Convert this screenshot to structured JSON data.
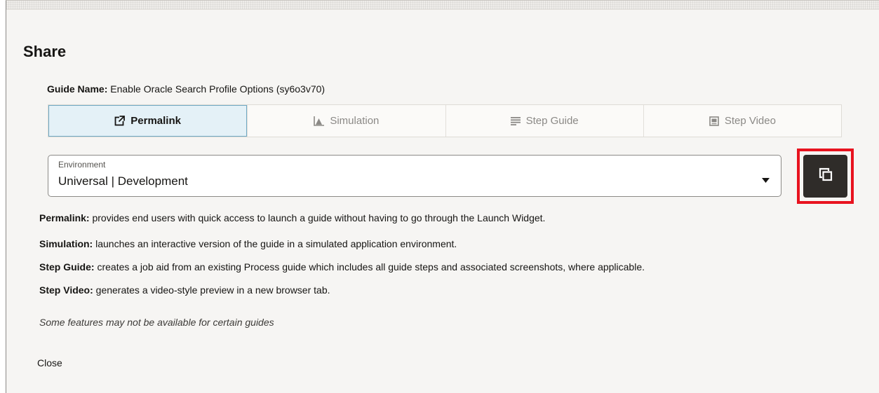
{
  "dialog": {
    "title": "Share",
    "guide_name_label": "Guide Name:",
    "guide_name_value": "Enable Oracle Search Profile Options (sy6o3v70)"
  },
  "tabs": [
    {
      "label": "Permalink",
      "icon": "external-link-icon",
      "active": true
    },
    {
      "label": "Simulation",
      "icon": "chart-icon",
      "active": false
    },
    {
      "label": "Step Guide",
      "icon": "lines-icon",
      "active": false
    },
    {
      "label": "Step Video",
      "icon": "video-icon",
      "active": false
    }
  ],
  "environment": {
    "label": "Environment",
    "value": "Universal | Development"
  },
  "copy_button": {
    "icon": "copy-icon",
    "highlight_color": "#e8131f"
  },
  "descriptions": [
    {
      "term": "Permalink:",
      "text": "provides end users with quick access to launch a guide without having to go through the Launch Widget."
    },
    {
      "term": "Simulation:",
      "text": "launches an interactive version of the guide in a simulated application environment."
    },
    {
      "term": "Step Guide:",
      "text": "creates a job aid from an existing Process guide which includes all guide steps and associated screenshots, where applicable."
    },
    {
      "term": "Step Video:",
      "text": "generates a video-style preview in a new browser tab."
    }
  ],
  "note": "Some features may not be available for certain guides",
  "footer": {
    "close_label": "Close"
  },
  "colors": {
    "active_tab_bg": "#e4f1f7",
    "active_tab_border": "#6fa9c4",
    "copy_button_bg": "#2f2c29"
  }
}
